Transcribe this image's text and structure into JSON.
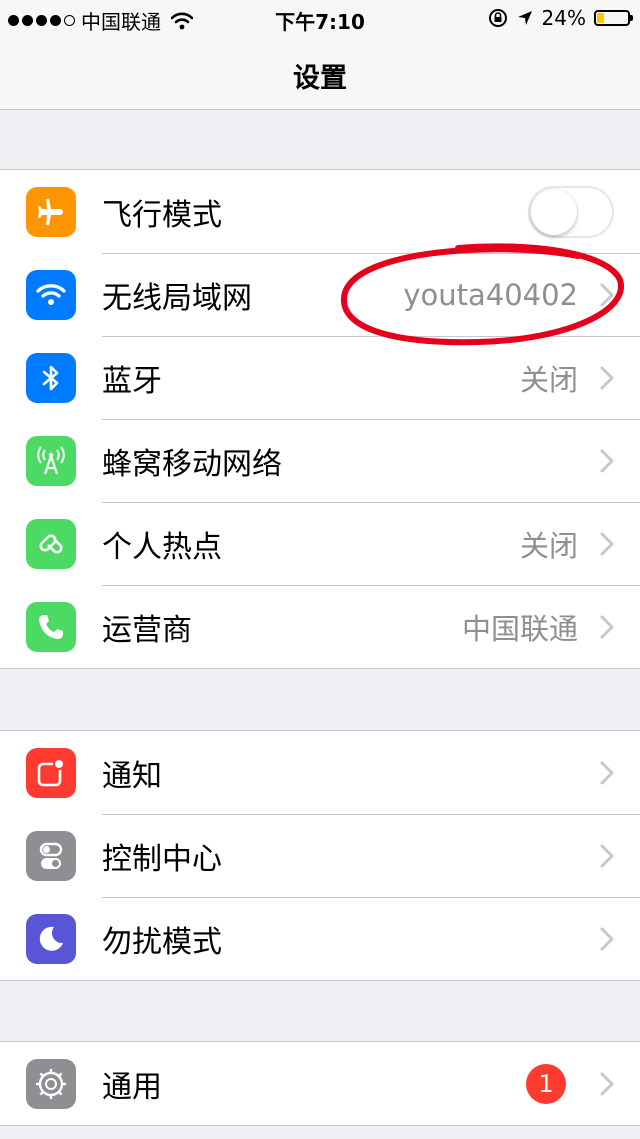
{
  "status_bar": {
    "carrier": "中国联通",
    "time": "下午7:10",
    "battery_percent": "24%",
    "battery_level": 0.24
  },
  "nav": {
    "title": "设置"
  },
  "colors": {
    "airplane": "#ff9500",
    "wifi": "#007aff",
    "bluetooth": "#007aff",
    "cellular": "#4cd964",
    "hotspot": "#4cd964",
    "carrier": "#4cd964",
    "notifications": "#ff3b30",
    "control_center": "#8e8e93",
    "dnd": "#5856d6",
    "general": "#8e8e93",
    "annotation": "#e5001b"
  },
  "group1": [
    {
      "label": "飞行模式",
      "icon": "airplane-icon",
      "control": "toggle",
      "toggle_on": false
    },
    {
      "label": "无线局域网",
      "icon": "wifi-icon",
      "value": "youta40402"
    },
    {
      "label": "蓝牙",
      "icon": "bluetooth-icon",
      "value": "关闭"
    },
    {
      "label": "蜂窝移动网络",
      "icon": "cellular-icon",
      "value": ""
    },
    {
      "label": "个人热点",
      "icon": "hotspot-icon",
      "value": "关闭"
    },
    {
      "label": "运营商",
      "icon": "carrier-phone-icon",
      "value": "中国联通"
    }
  ],
  "group2": [
    {
      "label": "通知",
      "icon": "notifications-icon"
    },
    {
      "label": "控制中心",
      "icon": "control-center-icon"
    },
    {
      "label": "勿扰模式",
      "icon": "moon-icon"
    }
  ],
  "group3": [
    {
      "label": "通用",
      "icon": "gear-icon",
      "badge": "1"
    }
  ]
}
